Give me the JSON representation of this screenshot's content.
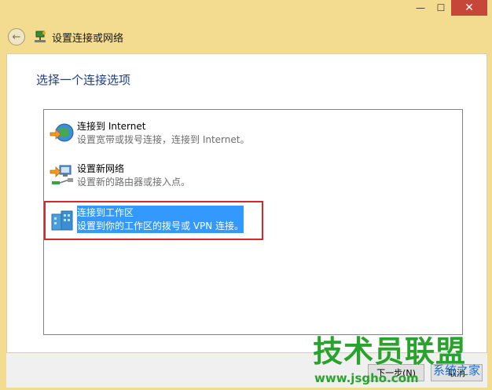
{
  "window": {
    "minimize_glyph": "—",
    "maximize_glyph": "☐",
    "close_glyph": "✕"
  },
  "nav": {
    "back_glyph": "←",
    "title": "设置连接或网络"
  },
  "main": {
    "heading": "选择一个连接选项",
    "options": [
      {
        "title": "连接到 Internet",
        "desc": "设置宽带或拨号连接，连接到 Internet。",
        "icon": "globe-internet-icon",
        "selected": false
      },
      {
        "title": "设置新网络",
        "desc": "设置新的路由器或接入点。",
        "icon": "new-network-icon",
        "selected": false
      },
      {
        "title": "连接到工作区",
        "desc": "设置到你的工作区的拨号或 VPN 连接。",
        "icon": "workplace-vpn-icon",
        "selected": true
      }
    ]
  },
  "footer": {
    "next_label": "下一步(N)",
    "cancel_label": "取消"
  },
  "watermark": {
    "title": "技术员联盟",
    "site": "www.jsgho.com",
    "tag": "系统之家"
  },
  "colors": {
    "chrome": "#f3dc8f",
    "heading": "#1e3f86",
    "selection": "#3399ff",
    "highlight_border": "#d9262b",
    "watermark_green": "#2aa32e"
  }
}
